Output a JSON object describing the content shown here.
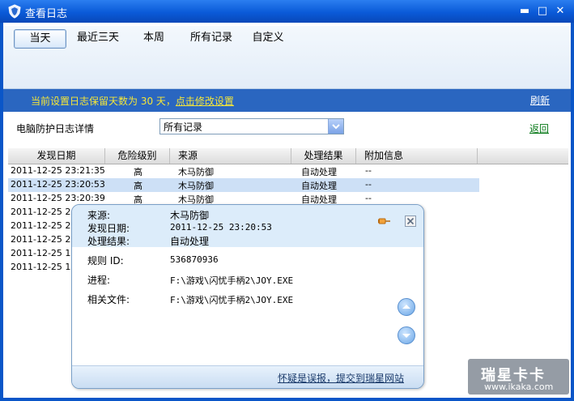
{
  "window": {
    "title": "查看日志",
    "controls": [
      "▬",
      "□",
      "✕"
    ]
  },
  "tabs": [
    {
      "label": "当天",
      "active": true
    },
    {
      "label": "最近三天",
      "active": false
    },
    {
      "label": "本周",
      "active": false
    },
    {
      "label": "所有记录",
      "active": false
    },
    {
      "label": "自定义",
      "active": false
    }
  ],
  "notice": {
    "prefix": "当前设置日志保留天数为 30 天，",
    "link": "点击修改设置"
  },
  "refresh_label": "刷新",
  "filter": {
    "label": "电脑防护日志详情",
    "selected": "所有记录"
  },
  "back_label": "返回",
  "table": {
    "columns": [
      "发现日期",
      "危险级别",
      "来源",
      "处理结果",
      "附加信息"
    ],
    "rows": [
      [
        "2011-12-25 23:21:35",
        "高",
        "木马防御",
        "自动处理",
        "--"
      ],
      [
        "2011-12-25 23:20:53",
        "高",
        "木马防御",
        "自动处理",
        "--"
      ],
      [
        "2011-12-25 23:20:39",
        "高",
        "木马防御",
        "自动处理",
        "--"
      ],
      [
        "2011-12-25 2",
        "",
        "",
        "",
        ""
      ],
      [
        "2011-12-25 2",
        "",
        "",
        "",
        ""
      ],
      [
        "2011-12-25 2",
        "",
        "",
        "",
        ""
      ],
      [
        "2011-12-25 1",
        "",
        "",
        "",
        ""
      ],
      [
        "2011-12-25 1",
        "",
        "",
        "",
        ""
      ]
    ]
  },
  "popup": {
    "source_label": "来源:",
    "source_value": "木马防御",
    "date_label": "发现日期:",
    "date_value": "2011-12-25 23:20:53",
    "result_label": "处理结果:",
    "result_value": "自动处理",
    "rule_label": "规则 ID:",
    "rule_value": "536870936",
    "process_label": "进程:",
    "process_value": "F:\\游戏\\闪忧手柄2\\JOY.EXE",
    "file_label": "相关文件:",
    "file_value": "F:\\游戏\\闪忧手柄2\\JOY.EXE",
    "report_link": "怀疑是误报，提交到瑞星网站"
  },
  "watermark": {
    "brand": "瑞星卡卡",
    "url": "www.ikaka.com"
  }
}
